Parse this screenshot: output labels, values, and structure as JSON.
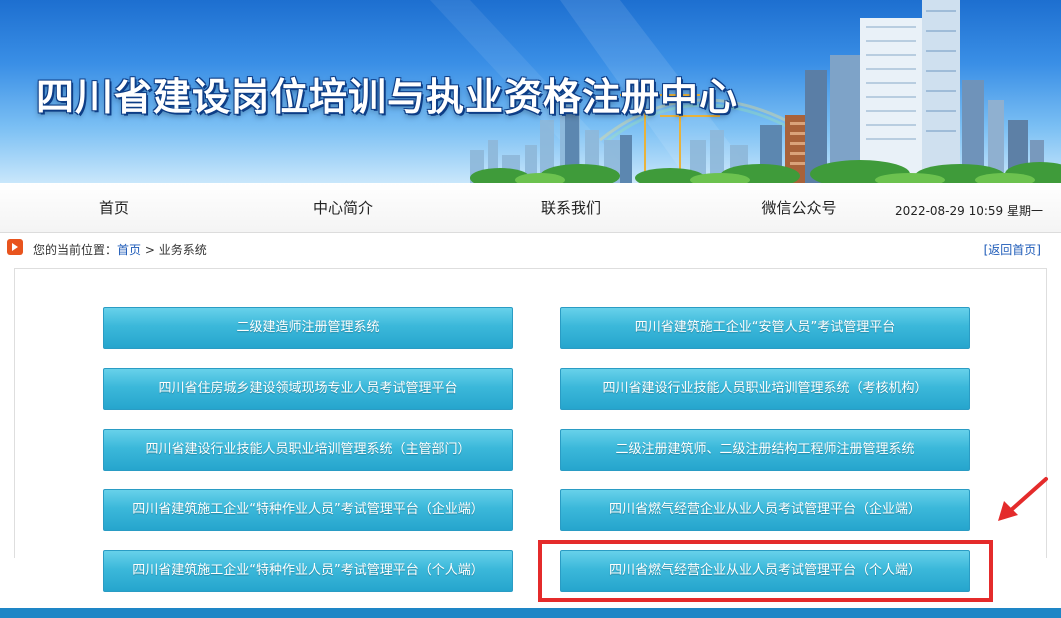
{
  "header": {
    "site_title": "四川省建设岗位培训与执业资格注册中心"
  },
  "nav": {
    "items": [
      {
        "label": "首页"
      },
      {
        "label": "中心简介"
      },
      {
        "label": "联系我们"
      },
      {
        "label": "微信公众号"
      }
    ],
    "datetime": "2022-08-29 10:59 星期一"
  },
  "breadcrumb": {
    "prefix": "您的当前位置：",
    "home": "首页",
    "separator": " > ",
    "current": "业务系统",
    "back_label": "[返回首页]"
  },
  "systems": [
    {
      "label": "二级建造师注册管理系统"
    },
    {
      "label": "四川省建筑施工企业“安管人员”考试管理平台"
    },
    {
      "label": "四川省住房城乡建设领域现场专业人员考试管理平台"
    },
    {
      "label": "四川省建设行业技能人员职业培训管理系统（考核机构）"
    },
    {
      "label": "四川省建设行业技能人员职业培训管理系统（主管部门）"
    },
    {
      "label": "二级注册建筑师、二级注册结构工程师注册管理系统"
    },
    {
      "label": "四川省建筑施工企业“特种作业人员”考试管理平台（企业端）"
    },
    {
      "label": "四川省燃气经营企业从业人员考试管理平台（企业端）"
    },
    {
      "label": "四川省建筑施工企业“特种作业人员”考试管理平台（个人端）"
    },
    {
      "label": "四川省燃气经营企业从业人员考试管理平台（个人端）"
    }
  ],
  "colors": {
    "button_top": "#67d1ea",
    "button_bottom": "#26a5cd",
    "annotation_red": "#e42b2b",
    "footer_blue": "#1e86c6",
    "link_blue": "#1e5bb8"
  }
}
